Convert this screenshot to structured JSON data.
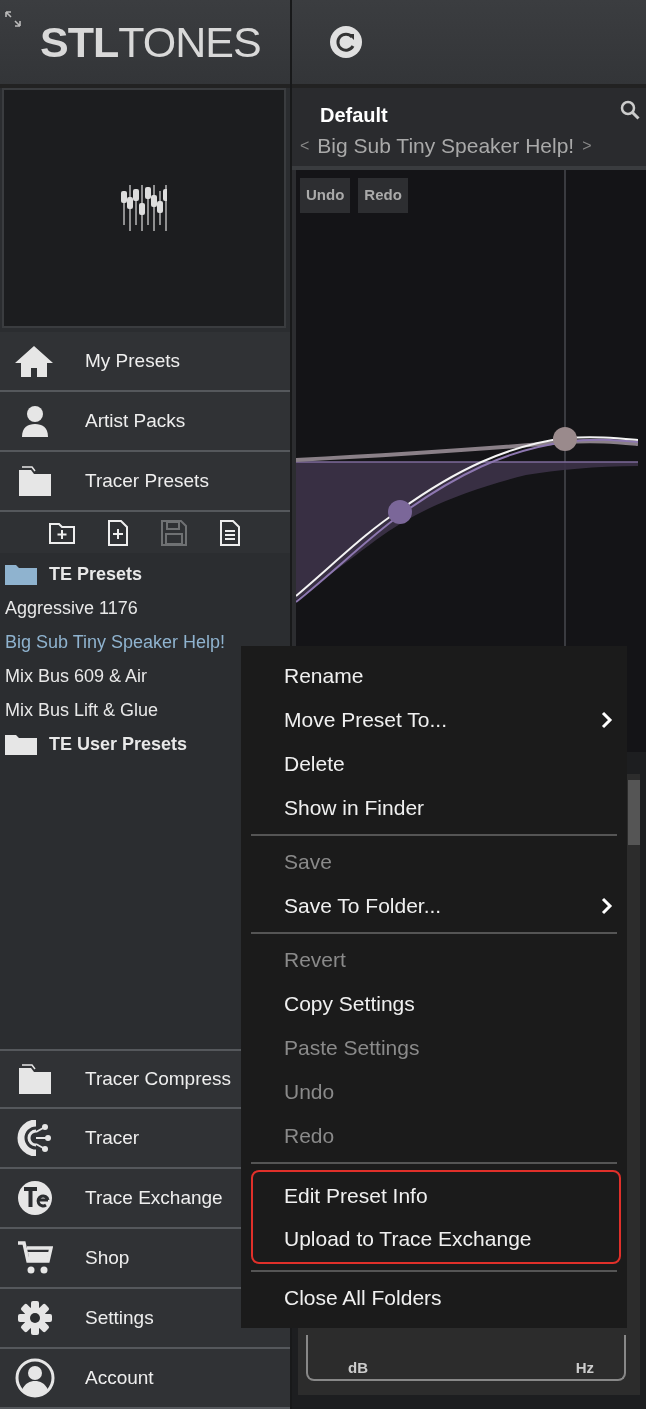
{
  "header": {
    "logo": "**STL**TONES"
  },
  "preset_header": {
    "bank": "Default",
    "prev": "<",
    "name": "Big Sub Tiny Speaker Help!",
    "next": ">"
  },
  "eq": {
    "undo": "Undo",
    "redo": "Redo"
  },
  "lower_panel": {
    "units": [
      "dB",
      "Hz"
    ]
  },
  "nav_top": [
    {
      "label": "My Presets"
    },
    {
      "label": "Artist Packs"
    },
    {
      "label": "Tracer Presets"
    }
  ],
  "preset_toolbar": [
    {
      "disabled": false
    },
    {
      "disabled": false
    },
    {
      "disabled": true
    },
    {
      "disabled": false
    }
  ],
  "tree": [
    {
      "label": "TE Presets",
      "color": "#8fb3cf",
      "children": [
        {
          "label": "Aggressive 1176",
          "selected": false
        },
        {
          "label": "Big Sub Tiny Speaker Help!",
          "selected": true
        },
        {
          "label": "Mix Bus 609 & Air",
          "selected": false
        },
        {
          "label": "Mix Bus Lift & Glue",
          "selected": false
        }
      ]
    },
    {
      "label": "TE User Presets",
      "color": "#e6e6e6"
    }
  ],
  "nav_bottom": [
    {
      "label": "Tracer Compress"
    },
    {
      "label": "Tracer"
    },
    {
      "label": "Trace Exchange"
    },
    {
      "label": "Shop"
    },
    {
      "label": "Settings"
    },
    {
      "label": "Account"
    }
  ],
  "context_menu": {
    "sections": [
      {
        "highlighted": false,
        "items": [
          {
            "label": "Rename",
            "disabled": false,
            "submenu": false
          },
          {
            "label": "Move Preset To...",
            "disabled": false,
            "submenu": true
          },
          {
            "label": "Delete",
            "disabled": false,
            "submenu": false
          },
          {
            "label": "Show in Finder",
            "disabled": false,
            "submenu": false
          }
        ]
      },
      {
        "highlighted": false,
        "items": [
          {
            "label": "Save",
            "disabled": true,
            "submenu": false
          },
          {
            "label": "Save To Folder...",
            "disabled": false,
            "submenu": true
          }
        ]
      },
      {
        "highlighted": false,
        "items": [
          {
            "label": "Revert",
            "disabled": true,
            "submenu": false
          },
          {
            "label": "Copy Settings",
            "disabled": false,
            "submenu": false
          },
          {
            "label": "Paste Settings",
            "disabled": true,
            "submenu": false
          },
          {
            "label": "Undo",
            "disabled": true,
            "submenu": false
          },
          {
            "label": "Redo",
            "disabled": true,
            "submenu": false
          }
        ]
      },
      {
        "highlighted": true,
        "items": [
          {
            "label": "Edit Preset Info",
            "disabled": false,
            "submenu": false
          },
          {
            "label": "Upload to Trace Exchange",
            "disabled": false,
            "submenu": false
          }
        ]
      },
      {
        "highlighted": false,
        "items": [
          {
            "label": "Close All Folders",
            "disabled": false,
            "submenu": false
          }
        ]
      }
    ]
  }
}
